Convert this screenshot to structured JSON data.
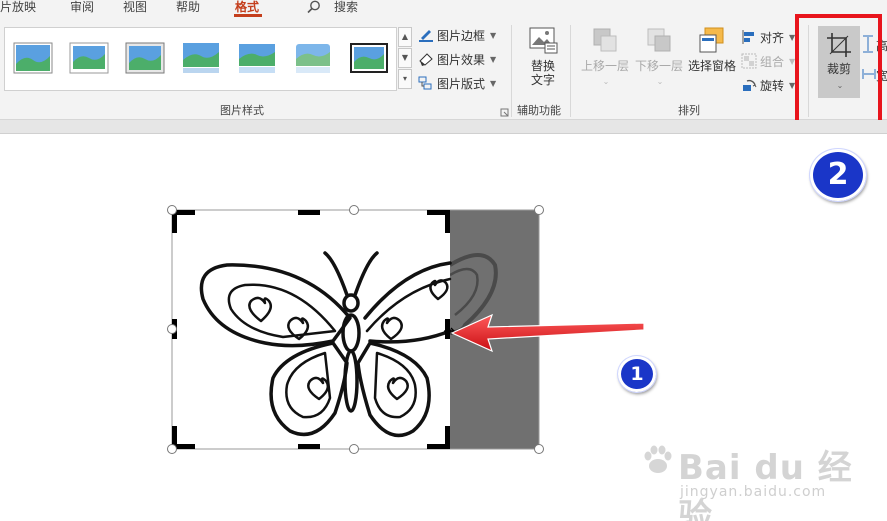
{
  "tabs": [
    {
      "label": "片放映",
      "active": false
    },
    {
      "label": "审阅",
      "active": false
    },
    {
      "label": "视图",
      "active": false
    },
    {
      "label": "帮助",
      "active": false
    },
    {
      "label": "格式",
      "active": true
    }
  ],
  "search": {
    "label": "搜索",
    "icon": "search-icon"
  },
  "picture_styles": {
    "group_label": "图片样式",
    "gallery_thumbnails": 7,
    "commands": [
      {
        "label": "图片边框",
        "icon": "pen-border-icon"
      },
      {
        "label": "图片效果",
        "icon": "effects-icon"
      },
      {
        "label": "图片版式",
        "icon": "layout-icon"
      }
    ]
  },
  "accessibility": {
    "group_label": "辅助功能",
    "alt_text": {
      "line1": "替换",
      "line2": "文字"
    }
  },
  "arrange": {
    "group_label": "排列",
    "bring_forward": "上移一层",
    "send_backward": "下移一层",
    "selection_pane": "选择窗格",
    "align": "对齐",
    "group": "组合",
    "rotate": "旋转"
  },
  "size": {
    "crop": "裁剪",
    "height_label": "高",
    "width_label": "宽"
  },
  "annotations": {
    "step_1": "1",
    "step_2": "2",
    "highlight_color": "#e8141c",
    "badge_color": "#1a36c8"
  },
  "watermark": {
    "main": "Bai du 经验",
    "sub": "jingyan.baidu.com"
  },
  "colors": {
    "accent": "#c43e1c",
    "ribbon_bg": "#f3f3f3",
    "crop_shade": "#707070"
  }
}
